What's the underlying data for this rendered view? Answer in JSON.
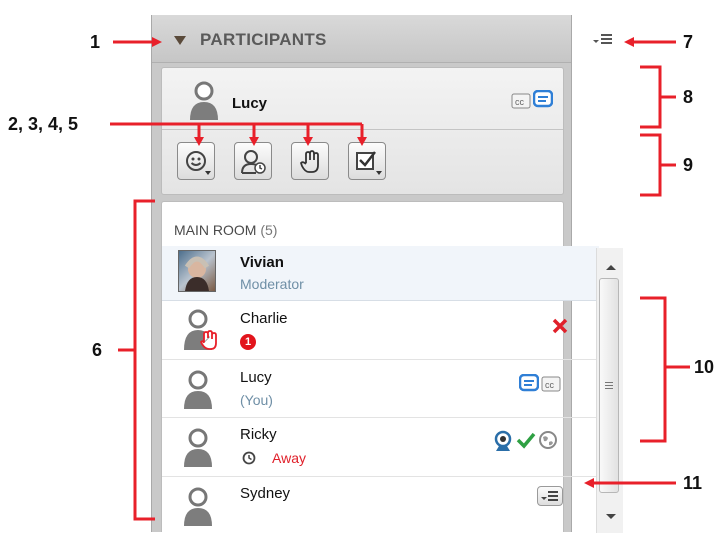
{
  "panel": {
    "title": "PARTICIPANTS",
    "options_menu_icon": "options-menu-icon"
  },
  "me": {
    "name": "Lucy",
    "icons": [
      "closed-caption-icon",
      "chat-icon"
    ],
    "toolbar": [
      {
        "name": "emoticon-button",
        "icon": "emoticon-icon"
      },
      {
        "name": "step-away-button",
        "icon": "step-away-icon"
      },
      {
        "name": "raise-hand-button",
        "icon": "raise-hand-icon"
      },
      {
        "name": "agree-button",
        "icon": "checkbox-icon"
      }
    ]
  },
  "room": {
    "title": "MAIN ROOM",
    "count": "(5)",
    "participants": [
      {
        "name": "Vivian",
        "sub": "Moderator",
        "role": "moderator"
      },
      {
        "name": "Charlie",
        "badge": "1",
        "status_icon": "close-icon"
      },
      {
        "name": "Lucy",
        "sub": "(You)",
        "icons": [
          "chat-icon",
          "closed-caption-icon"
        ]
      },
      {
        "name": "Ricky",
        "sub": "Away",
        "icons": [
          "webcam-icon",
          "checkmark-icon",
          "globe-icon"
        ]
      },
      {
        "name": "Sydney",
        "icons": [
          "options-menu-icon"
        ]
      }
    ]
  },
  "callouts": {
    "c1": "1",
    "c2345": "2, 3, 4, 5",
    "c6": "6",
    "c7": "7",
    "c8": "8",
    "c9": "9",
    "c10": "10",
    "c11": "11"
  },
  "colors": {
    "callout_red": "#e8202a",
    "accent_blue": "#2f7fd6",
    "away_red": "#e0202a",
    "moderator_text": "#6f8fa6"
  }
}
